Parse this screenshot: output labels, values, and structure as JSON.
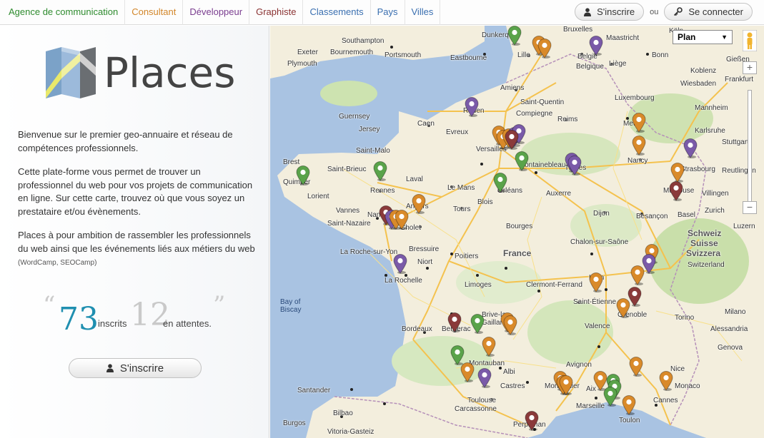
{
  "nav": {
    "items": [
      {
        "label": "Agence de communication",
        "color": "#2e8b2e"
      },
      {
        "label": "Consultant",
        "color": "#d2862a"
      },
      {
        "label": "Développeur",
        "color": "#7a3d8f"
      },
      {
        "label": "Graphiste",
        "color": "#8a3232"
      },
      {
        "label": "Classements",
        "color": "#3a6fb0"
      },
      {
        "label": "Pays",
        "color": "#3a6fb0"
      },
      {
        "label": "Villes",
        "color": "#3a6fb0"
      }
    ]
  },
  "auth": {
    "signup_label": "S'inscrire",
    "or_label": "ou",
    "login_label": "Se connecter"
  },
  "brand": {
    "name": "Places"
  },
  "intro": {
    "p1": "Bienvenue sur le premier geo-annuaire et réseau de compétences professionnels.",
    "p2": "Cette plate-forme vous permet de trouver un professionnel du web pour vos projets de communication en ligne. Sur cette carte, trouvez où que vous soyez un prestataire et/ou évènements.",
    "p3": "Places à pour ambition de rassembler les professionnels du web ainsi que les événements liés aux métiers du web",
    "p3_small": "(WordCamp, SEOCamp)"
  },
  "stats": {
    "open_quote": "“",
    "close_quote": "”",
    "registered": "73",
    "registered_label": "inscrits",
    "pending": "12",
    "pending_label": "en attentes."
  },
  "cta": {
    "signup_label": "S'inscrire"
  },
  "map": {
    "type_label": "Plan",
    "zoom_in": "+",
    "zoom_out": "−",
    "labels": {
      "southampton": "Southampton",
      "bournemouth": "Bournemouth",
      "exeter": "Exeter",
      "plymouth": "Plymouth",
      "portsmouth": "Portsmouth",
      "eastbourne": "Eastbourne",
      "dunkerque": "Dunkerque",
      "bruxelles": "Bruxelles",
      "maastricht": "Maastricht",
      "koln": "Köln",
      "lille": "Lille",
      "belgie": "België",
      "belgique": "Belgique",
      "liege": "Liège",
      "bonn": "Bonn",
      "koblenz": "Koblenz",
      "frankfurt": "Frankfurt",
      "wiesbaden": "Wiesbaden",
      "giessen": "Gießen",
      "amiens": "Amiens",
      "guernsey": "Guernsey",
      "jersey": "Jersey",
      "rouen": "Rouen",
      "caen": "Caen",
      "compiegne": "Compiegne",
      "saintquentin": "Saint-Quentin",
      "reims": "Reims",
      "luxembourg": "Luxembourg",
      "mannheim": "Mannheim",
      "karlsruhe": "Karlsruhe",
      "stuttgart": "Stuttgart",
      "evreux": "Evreux",
      "versailles": "Versailles",
      "metz": "Metz",
      "nancy": "Nancy",
      "strasbourg": "Strasbourg",
      "brest": "Brest",
      "saintmalo": "Saint-Malo",
      "saintbrieuc": "Saint-Brieuc",
      "quimper": "Quimper",
      "rennes": "Rennes",
      "laval": "Laval",
      "lemans": "Le Mans",
      "orleans": "Orléans",
      "fontainebleau": "Fontainebleau",
      "troyes": "Troyes",
      "mulhouse": "Mulhouse",
      "villingen": "Villingen",
      "reutlingen": "Reutlingen",
      "zurich": "Zurich",
      "basel": "Basel",
      "lorient": "Lorient",
      "vannes": "Vannes",
      "angers": "Angers",
      "tours": "Tours",
      "blois": "Blois",
      "auxerre": "Auxerre",
      "dijon": "Dijon",
      "besancon": "Besançon",
      "saintnazaire": "Saint-Nazaire",
      "nantes": "Nantes",
      "cholet": "Cholet",
      "bourges": "Bourges",
      "schweiz": "Schweiz",
      "suisse": "Suisse",
      "svizzera": "Svizzera",
      "switzerland": "Switzerland",
      "larochesuryon": "La Roche-sur-Yon",
      "bressuire": "Bressuire",
      "poitiers": "Poitiers",
      "france": "France",
      "chalon": "Chalon-sur-Saône",
      "larochelle": "La Rochelle",
      "niort": "Niort",
      "limoges": "Limoges",
      "clermont": "Clermont-Ferrand",
      "lyon": "Lyon",
      "bayofbiscay": "Bay of Biscay",
      "saintetienne": "Saint-Étienne",
      "grenoble": "Grenoble",
      "torino": "Torino",
      "milano": "Milano",
      "bergerac": "Bergerac",
      "bordeaux": "Bordeaux",
      "brive": "Brive-la-Gaillarde",
      "valence": "Valence",
      "genova": "Genova",
      "albi": "Albi",
      "montauban": "Montauban",
      "castres": "Castres",
      "montpellier": "Montpellier",
      "aix": "Aix",
      "avignon": "Avignon",
      "nice": "Nice",
      "cannes": "Cannes",
      "monaco": "Monaco",
      "santander": "Santander",
      "bilbao": "Bilbao",
      "burgos": "Burgos",
      "toulouse": "Toulouse",
      "carcassonne": "Carcassonne",
      "marseille": "Marseille",
      "toulon": "Toulon",
      "perpignan": "Perpignan",
      "vitoria": "Vitoria-Gasteiz",
      "alessandria": "Alessandria",
      "luzern": "Luzern"
    }
  }
}
